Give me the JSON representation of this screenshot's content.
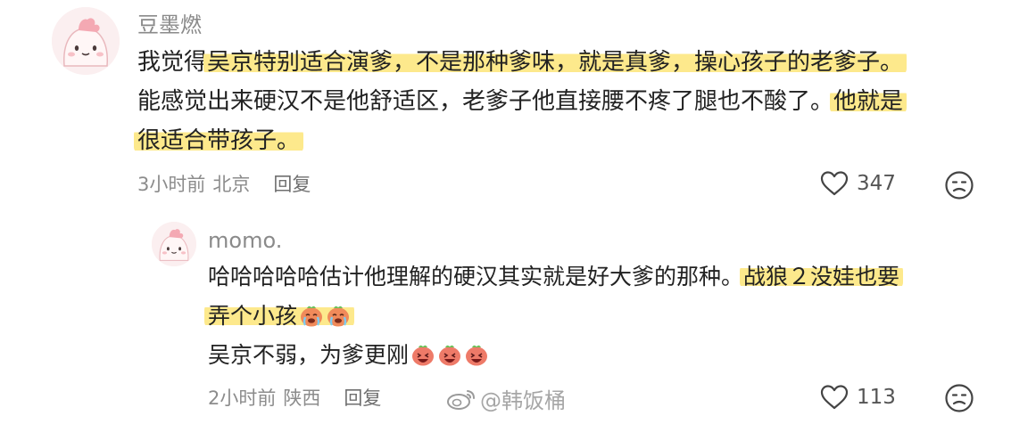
{
  "main_comment": {
    "username": "豆墨燃",
    "lines": [
      [
        "我觉得",
        "吴京特别适合演爹，不是那种爹味，就是真爹，操心孩子的老爹子。"
      ],
      [
        "能感觉出来硬汉不是他舒适区，老爹子他直接腰不疼了腿也不酸了。",
        "他就是"
      ],
      [
        "很适合带孩子。"
      ]
    ],
    "time": "3小时前",
    "location": "北京",
    "reply_label": "回复",
    "likes": "347"
  },
  "reply_comment": {
    "username": "momo.",
    "line1": [
      "哈哈哈哈哈估计他理解的硬汉其实就是好大爹的那种。",
      "战狼２没娃也要"
    ],
    "line2": "弄个小孩",
    "line3": "吴京不弱，为爹更刚",
    "time": "2小时前",
    "location": "陕西",
    "reply_label": "回复",
    "likes": "113"
  },
  "watermark": "@韩饭桶",
  "colors": {
    "highlight": "#fde98c",
    "meta_text": "#8c8c8c",
    "username": "#8a8a8a",
    "avatar_bg": "#fbeff0"
  },
  "icons": {
    "like": "heart-outline-icon",
    "dislike": "frown-face-icon",
    "emoji_cry": "crying-face-emoji",
    "emoji_cheer": "cheering-face-emoji",
    "watermark": "weibo-logo-icon"
  }
}
